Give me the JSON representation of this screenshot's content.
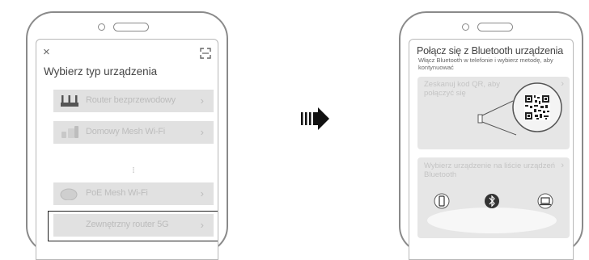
{
  "left_phone": {
    "close_icon": "×",
    "scan_icon": "⛶",
    "title": "Wybierz typ urządzenia",
    "items": [
      {
        "label": "Router bezprzewodowy",
        "icon": "router-icon"
      },
      {
        "label": "Domowy Mesh Wi-Fi",
        "icon": "mesh-icon"
      },
      {
        "label": "PoE Mesh Wi-Fi",
        "icon": "poe-mesh-icon"
      },
      {
        "label": "Zewnętrzny router 5G",
        "icon": "none"
      }
    ],
    "chevron": "›",
    "ellipsis": "⋮"
  },
  "right_phone": {
    "title": "Połącz się z Bluetooth urządzenia",
    "subtitle": "Włącz Bluetooth w telefonie i wybierz metodę, aby kontynuować",
    "qr_card": {
      "label": "Zeskanuj kod QR, aby połączyć się",
      "chevron": "›"
    },
    "list_card": {
      "label": "Wybierz urządzenie na liście urządzeń Bluetooth",
      "chevron": "›"
    }
  },
  "colors": {
    "row_bg": "#e1e1e1",
    "highlight_border": "#222222",
    "phone_border": "#8a8a8a"
  }
}
